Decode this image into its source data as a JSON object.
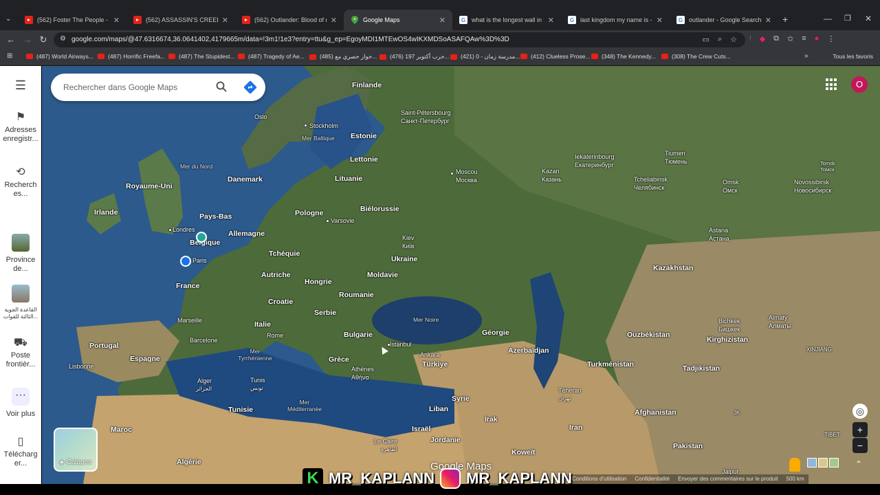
{
  "tabs": [
    {
      "title": "(562) Foster The People - Pump",
      "favicon": "youtube-icon",
      "active": false
    },
    {
      "title": "(562) ASSASSIN'S CREED VALHA",
      "favicon": "youtube-icon",
      "active": false
    },
    {
      "title": "(562) Outlander: Blood of my B",
      "favicon": "youtube-icon",
      "active": false
    },
    {
      "title": "Google Maps",
      "favicon": "maps-icon",
      "active": true
    },
    {
      "title": "what is the longest wall in the w",
      "favicon": "google-icon",
      "active": false
    },
    {
      "title": "last kingdom my name is - Goo",
      "favicon": "google-icon",
      "active": false
    },
    {
      "title": "outlander - Google Search",
      "favicon": "google-icon",
      "active": false
    }
  ],
  "omnibar": {
    "url": "google.com/maps/@47.6316674,36.0641402,4179665m/data=!3m1!1e3?entry=ttu&g_ep=EgoyMDI1MTEwOS4wIKXMDSoASAFQAw%3D%3D"
  },
  "bookmarks": [
    "(487) World Airways...",
    "(487) Horrific Freefa...",
    "(487) The Stupidest...",
    "(487) Tragedy of Ae...",
    "(485) حوار حصري مع...",
    "(476) حرب أكتوبر 197...",
    "(421) مدرسة زمان - 0...",
    "(412) Clueless Prose...",
    "(348) The Kennedy...",
    "(308) The Crew Cuts..."
  ],
  "bookmarks_all": "Tous les favoris",
  "search": {
    "placeholder": "Rechercher dans Google Maps"
  },
  "sidebar": {
    "saved": "Adresses enregistr...",
    "recent": "Recherch es...",
    "province": "Province de...",
    "airbase": "القاعدة الجوية الثالثة للقوات...",
    "border": "Poste frontièr...",
    "more": "Voir plus",
    "download": "Télécharg er..."
  },
  "layers_label": "Calques",
  "avatar_letter": "O",
  "map_labels": {
    "countries": [
      "Finlande",
      "Estonie",
      "Lettonie",
      "Lituanie",
      "Danemark",
      "Royaume-Uni",
      "Irlande",
      "Pays-Bas",
      "Belgique",
      "Allemagne",
      "Pologne",
      "Biélorussie",
      "Ukraine",
      "Tchéquie",
      "Autriche",
      "Hongrie",
      "Moldavie",
      "Roumanie",
      "France",
      "Croatie",
      "Serbie",
      "Italie",
      "Bulgarie",
      "Portugal",
      "Espagne",
      "Grèce",
      "Türkiye",
      "Géorgie",
      "Azerbaïdjan",
      "Kazakhstan",
      "Ouzbékistan",
      "Turkménistan",
      "Kirghizistan",
      "Tadjikistan",
      "Afghanistan",
      "Iran",
      "Irak",
      "Syrie",
      "Liban",
      "Israël",
      "Jordanie",
      "Koweït",
      "Pakistan",
      "Tunisie",
      "Maroc",
      "Algérie"
    ],
    "cities": [
      "Oslo",
      "Stockholm",
      "Saint-Pétersbourg",
      "Санкт-Петербург",
      "Moscou",
      "Москва",
      "Kazan",
      "Казань",
      "Iekaterinbourg",
      "Екатеринбург",
      "Tiumen",
      "Тюмень",
      "Tomsk",
      "Томск",
      "Tcheliabinsk",
      "Челябинск",
      "Omsk",
      "Омск",
      "Novossibirsk",
      "Новосибирск",
      "Astana",
      "Астана",
      "Londres",
      "Paris",
      "Varsovie",
      "Kiev",
      "Київ",
      "Marseille",
      "Barcelone",
      "Rome",
      "Lisbonne",
      "Alger",
      "الجزائر",
      "Tunis",
      "تونس",
      "Athènes",
      "Αθήνα",
      "Istanbul",
      "Ankara",
      "Téhéran",
      "تهران",
      "Bichkek",
      "Бишкек",
      "Almaty",
      "Алматы",
      "Le Caire",
      "القاهرة",
      "Jaipur"
    ],
    "seas": [
      "Mer du Nord",
      "Mer Baltique",
      "Mer Noire",
      "Mer Tyrrhénienne",
      "Mer Méditerranée"
    ],
    "regions": [
      "XINJIANG",
      "TIBET",
      "JK"
    ]
  },
  "bottom_links": [
    "Conditions d'utilisation",
    "Confidentialité",
    "Envoyer des commentaires sur le produit",
    "500 km"
  ],
  "watermark": "MR_KAPLANN",
  "watermark_k": "K",
  "maps_logo": "Google Maps"
}
